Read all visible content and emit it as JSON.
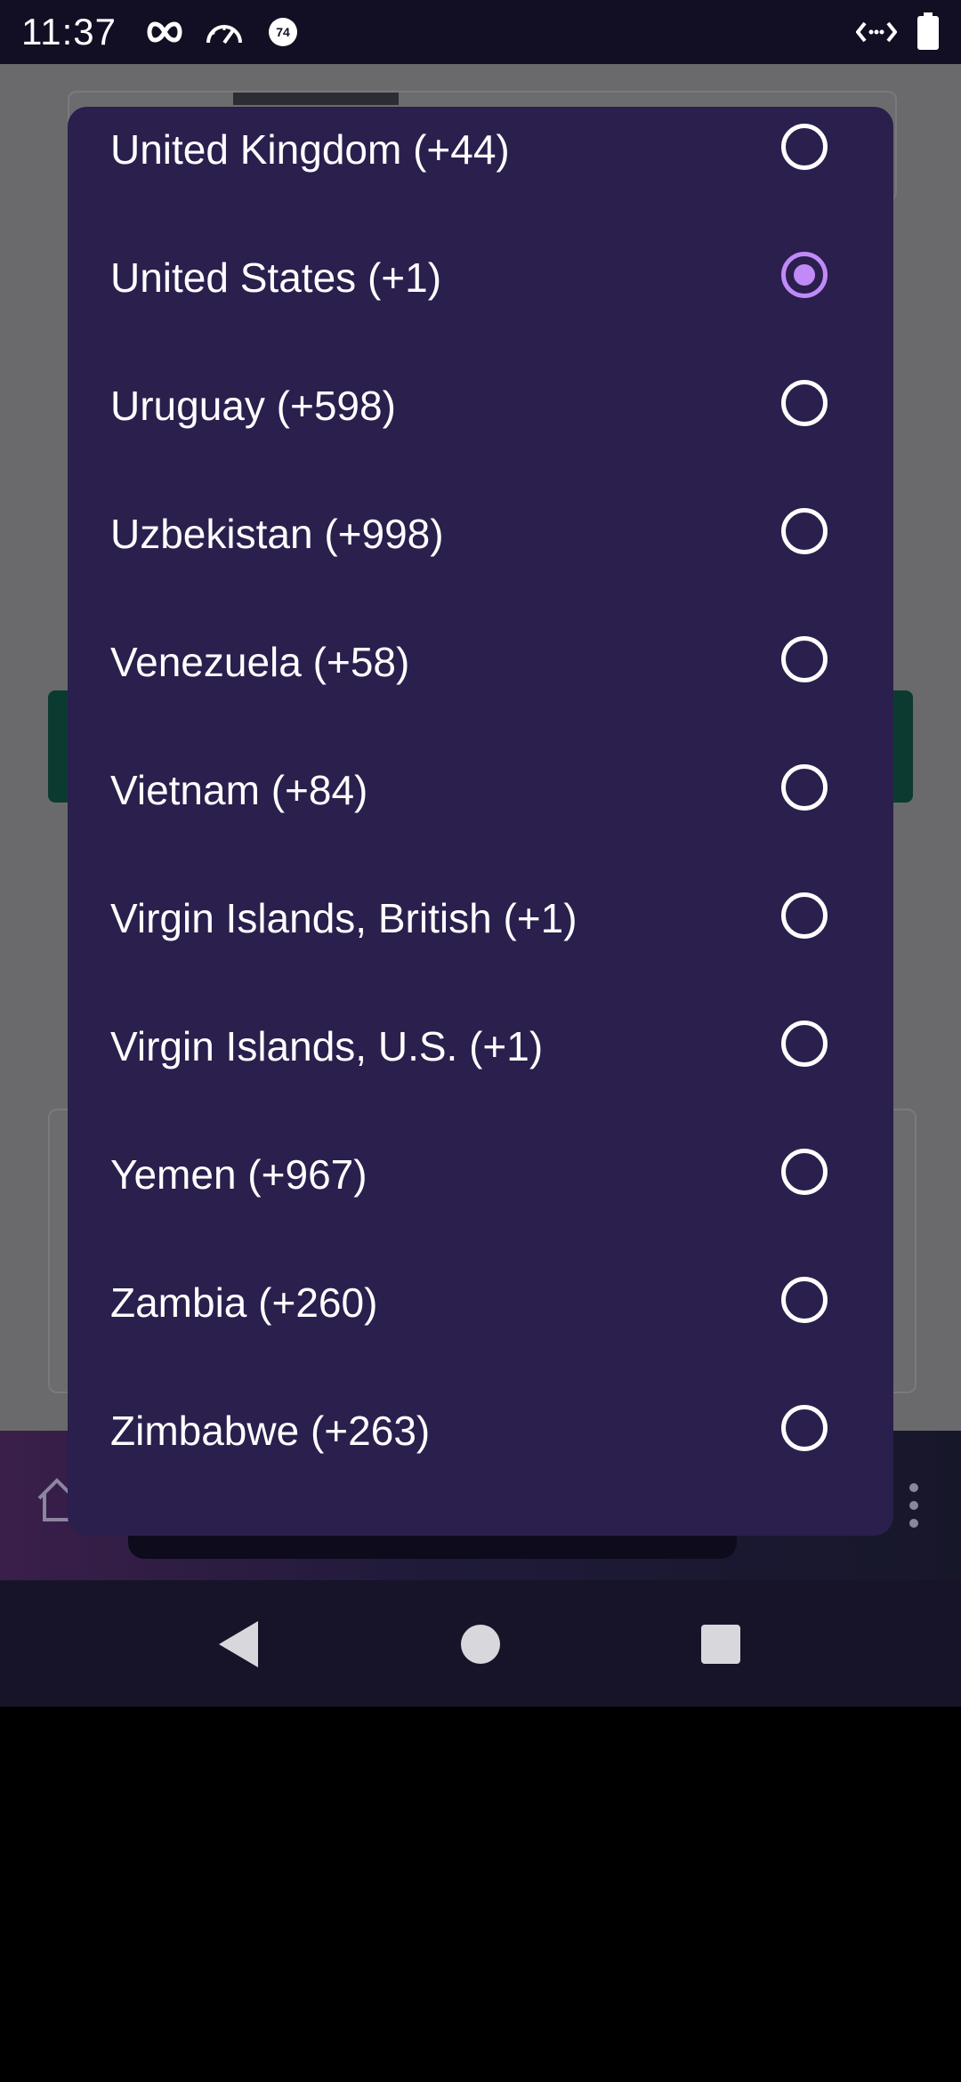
{
  "status_bar": {
    "time": "11:37",
    "notification_icons": [
      "infinity-icon",
      "speedometer-icon",
      "badge-74-icon"
    ],
    "badge_number": "74",
    "right_icons": [
      "code-arrows-icon",
      "battery-icon"
    ]
  },
  "dialog": {
    "selected": "United States (+1)",
    "items": [
      {
        "label": "United Kingdom (+44)",
        "checked": false
      },
      {
        "label": "United States (+1)",
        "checked": true
      },
      {
        "label": "Uruguay (+598)",
        "checked": false
      },
      {
        "label": "Uzbekistan (+998)",
        "checked": false
      },
      {
        "label": "Venezuela (+58)",
        "checked": false
      },
      {
        "label": "Vietnam (+84)",
        "checked": false
      },
      {
        "label": "Virgin Islands, British (+1)",
        "checked": false
      },
      {
        "label": "Virgin Islands, U.S. (+1)",
        "checked": false
      },
      {
        "label": "Yemen (+967)",
        "checked": false
      },
      {
        "label": "Zambia (+260)",
        "checked": false
      },
      {
        "label": "Zimbabwe (+263)",
        "checked": false
      }
    ]
  },
  "navigation": {
    "buttons": [
      "back-icon",
      "home-icon",
      "recents-icon"
    ]
  },
  "colors": {
    "dialog_bg": "#2a1f4d",
    "radio_checked": "#c08af8",
    "status_bar_bg": "#120f24"
  }
}
